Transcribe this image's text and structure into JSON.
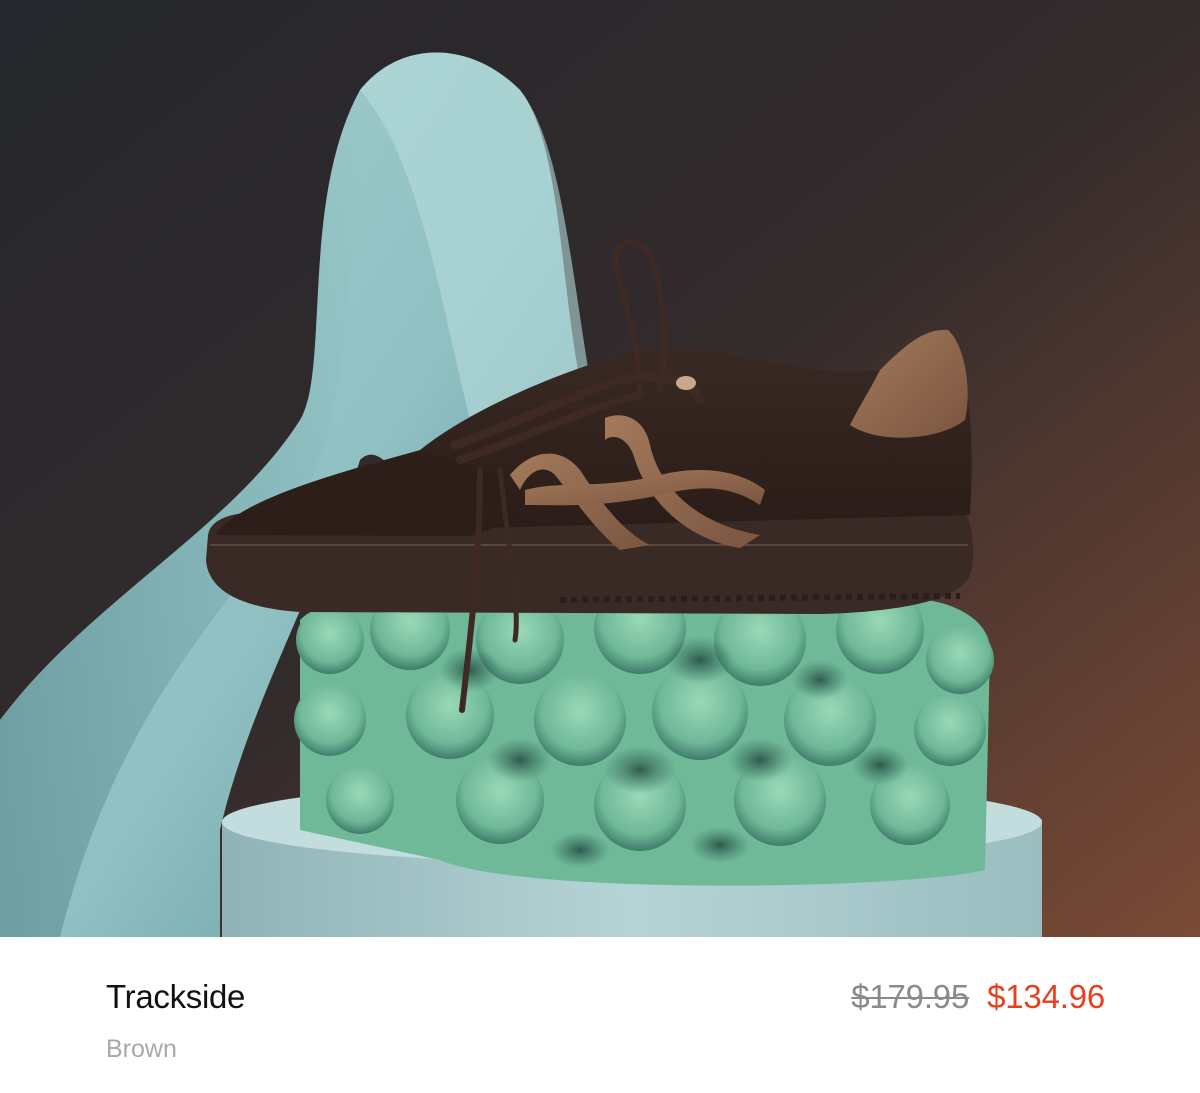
{
  "product": {
    "name": "Trackside",
    "color_name": "Brown",
    "original_price": "$179.95",
    "sale_price": "$134.96",
    "image_alt": "Brown leather sneaker with tan side stripes on sculpted foam blocks"
  },
  "colors": {
    "sale_price": "#e8401f",
    "original_price": "#8a8a8a",
    "product_name": "#111111",
    "color_name": "#a9a9a9"
  }
}
